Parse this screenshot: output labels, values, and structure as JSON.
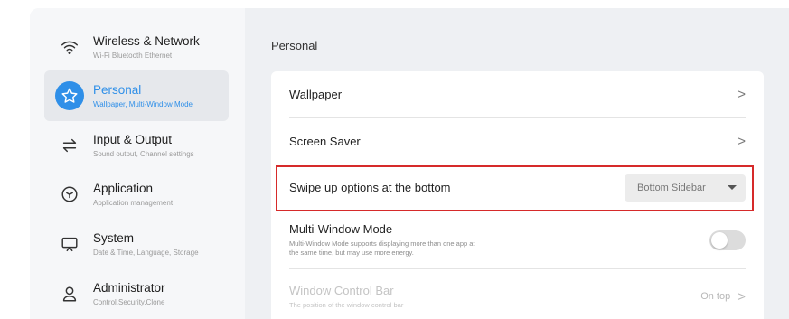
{
  "sidebar": {
    "items": [
      {
        "title": "Wireless & Network",
        "subtitle": "Wi-Fi Bluetooth Ethernet",
        "icon": "wifi-icon"
      },
      {
        "title": "Personal",
        "subtitle": "Wallpaper, Multi-Window Mode",
        "icon": "star-icon"
      },
      {
        "title": "Input & Output",
        "subtitle": "Sound output, Channel settings",
        "icon": "swap-arrows-icon"
      },
      {
        "title": "Application",
        "subtitle": "Application management",
        "icon": "cube-icon"
      },
      {
        "title": "System",
        "subtitle": "Date & Time, Language, Storage",
        "icon": "monitor-icon"
      },
      {
        "title": "Administrator",
        "subtitle": "Control,Security,Clone",
        "icon": "user-icon"
      }
    ],
    "active_index": 1
  },
  "main": {
    "section_title": "Personal",
    "rows": {
      "wallpaper": {
        "title": "Wallpaper"
      },
      "screen_saver": {
        "title": "Screen Saver"
      },
      "swipe": {
        "title": "Swipe up options at the bottom",
        "value": "Bottom Sidebar"
      },
      "multi_window": {
        "title": "Multi-Window Mode",
        "desc_line1": "Multi-Window Mode supports displaying more than one app at",
        "desc_line2": "the same time, but may use more energy.",
        "enabled": false
      },
      "window_control": {
        "title": "Window Control Bar",
        "desc": "The position of the window control bar",
        "value": "On top"
      }
    },
    "chevron": ">"
  },
  "colors": {
    "accent": "#2f8fe8",
    "highlight_border": "#d62a2a",
    "background": "#eef0f3"
  }
}
